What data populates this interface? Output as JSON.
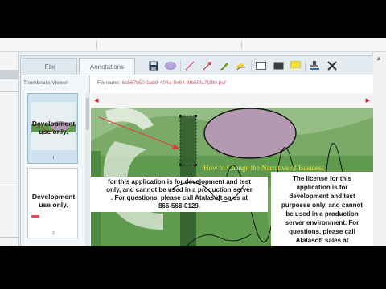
{
  "viewer": {
    "tabs": {
      "file": "File",
      "annotations": "Annotations"
    },
    "thumbnails_title": "Thumbnails Viewer",
    "filename_label": "Filename:",
    "filename_value": "6c567b50-5ab9-404a-9e64-f9b50fa7f280.pdf",
    "toolbar_icons": [
      "save-icon",
      "ellipse-icon",
      "line-icon",
      "arrow-icon",
      "freehand-pen-icon",
      "highlighter-icon",
      "rectangle-outline-icon",
      "filled-rectangle-icon",
      "sticky-note-icon",
      "rubber-stamp-icon",
      "delete-icon"
    ],
    "thumbnails": [
      {
        "line1": "Development",
        "line2": "use only.",
        "page": "1",
        "selected": true
      },
      {
        "line1": "Development",
        "line2": "use only.",
        "page": "2",
        "selected": false
      }
    ]
  },
  "document": {
    "heading": "How to Change the Narrative of Business",
    "left_text": [
      "for this application is for development and test",
      "only, and cannot be used in a production server",
      ". For questions, please call Atalasoft sales at",
      "866-568-0129."
    ],
    "right_text": [
      "The license for this",
      "application is for",
      "development and test",
      "purposes only, and cannot",
      "be used in a production",
      "server environment. For",
      "questions, please call",
      "Atalasoft sales at"
    ],
    "colors": {
      "background": "#5f9a4e",
      "ellipse_fill": "#b49ab0",
      "heading": "#e6e34a",
      "arrow": "#e23838"
    }
  }
}
